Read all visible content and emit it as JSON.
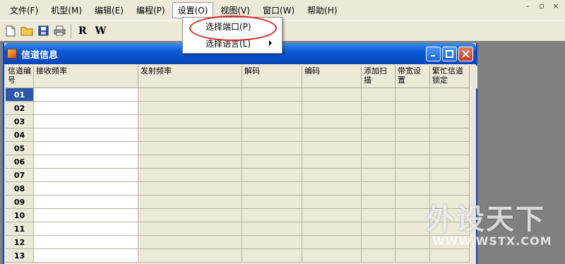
{
  "menubar": {
    "items": [
      {
        "label": "文件(F)"
      },
      {
        "label": "机型(M)"
      },
      {
        "label": "编辑(E)"
      },
      {
        "label": "编程(P)"
      },
      {
        "label": "设置(O)"
      },
      {
        "label": "视图(V)"
      },
      {
        "label": "窗口(W)"
      },
      {
        "label": "帮助(H)"
      }
    ],
    "window_controls": [
      "-",
      "▫",
      "×"
    ]
  },
  "toolbar": {
    "read_label": "R",
    "write_label": "W"
  },
  "settings_menu": {
    "items": [
      {
        "label": "选择端口(P)"
      },
      {
        "label": "选择语言(L)"
      }
    ]
  },
  "channel_window": {
    "title": "信道信息",
    "columns": [
      "信道编号",
      "接收频率",
      "发射频率",
      "解码",
      "编码",
      "添加扫描",
      "带宽设置",
      "繁忙信道锁定"
    ],
    "rows": [
      "01",
      "02",
      "03",
      "04",
      "05",
      "06",
      "07",
      "08",
      "09",
      "10",
      "11",
      "12",
      "13"
    ]
  },
  "watermark": {
    "logo": "外设天下",
    "url": "WWW.WSTX.COM"
  },
  "colors": {
    "titlebar": "#0a58d8",
    "annotation": "#e02020",
    "selected_row": "#2c56a8"
  }
}
